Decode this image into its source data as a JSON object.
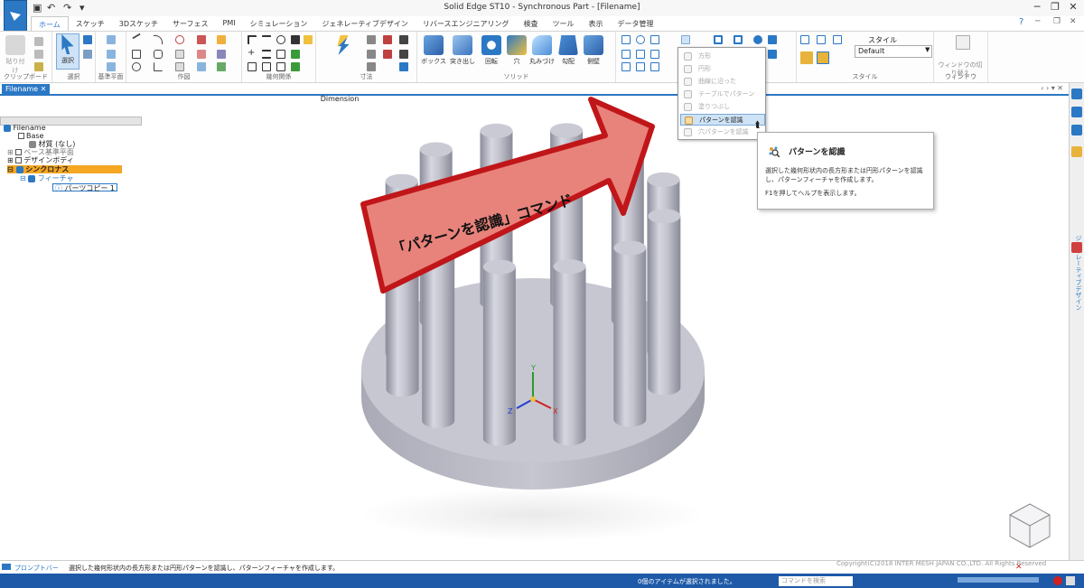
{
  "titlebar": {
    "title": "Solid Edge ST10 - Synchronous Part - [Filename]",
    "help": "?",
    "minimize": "─",
    "restore": "❐",
    "close": "✕"
  },
  "tabs": [
    "ホーム",
    "スケッチ",
    "3Dスケッチ",
    "サーフェス",
    "PMI",
    "シミュレーション",
    "ジェネレーティブデザイン",
    "リバースエンジニアリング",
    "検査",
    "ツール",
    "表示",
    "データ管理"
  ],
  "ribbon": {
    "clipboard": {
      "paste": "貼り付け",
      "group": "クリップボード"
    },
    "select": {
      "label": "選択",
      "group": "選択"
    },
    "plane": {
      "group": "基準平面"
    },
    "draw": {
      "group": "作図"
    },
    "relate": {
      "group": "幾何関係"
    },
    "dimension": {
      "smart": "Smart Dimension",
      "group": "寸法"
    },
    "solids": {
      "box": "ボックス",
      "extrude": "突き出し",
      "revolve": "回転",
      "hole": "穴",
      "round": "丸みづけ",
      "draft": "勾配",
      "thin": "側壁",
      "group": "ソリッド"
    },
    "face": {
      "group": "面幾何関係"
    },
    "style": {
      "label": "スタイル",
      "value": "Default",
      "group": "スタイル"
    },
    "window": {
      "switch": "ウィンドウの切り替え",
      "group": "ウィンドウ"
    }
  },
  "doctab": {
    "name": "Filename"
  },
  "pathfinder": {
    "root": "Filename",
    "items": [
      "Base",
      "材質 (なし)",
      "ベース基準平面",
      "デザインボディ",
      "シンクロナス",
      "フィーチャ",
      "パーツコピー 1"
    ]
  },
  "dropdown": {
    "items": [
      "方形",
      "円形",
      "曲線に沿った",
      "テーブルでパターン",
      "塗りつぶし",
      "パターンを認識",
      "穴パターンを認識"
    ]
  },
  "tooltip": {
    "title": "パターンを認識",
    "body": "選択した幾何形状内の長方形または円形パターンを認識し、パターンフィーチャを作成します。",
    "help": "F1を押してヘルプを表示します。"
  },
  "callout": {
    "text": "「パターンを認識」コマンド",
    "color": "#e8837b",
    "border": "#c0161a"
  },
  "dock": {
    "vertical_label": "ジェネレーティブデザイン"
  },
  "prompt": {
    "label": "プロンプトバー",
    "text": "選択した幾何形状内の長方形または円形パターンを認識し、パターンフィーチャを作成します。",
    "copyright": "Copyright(C)2018 INTER MESH JAPAN CO.,LTD. All Rights Reserved"
  },
  "status": {
    "selection": "0個のアイテムが選択されました。",
    "search_placeholder": "コマンドを検索"
  },
  "axes": {
    "x": "X",
    "y": "Y",
    "z": "Z"
  },
  "colors": {
    "accent": "#2b78c5",
    "status": "#1e5aa8",
    "sync_highlight": "#f5a623"
  }
}
